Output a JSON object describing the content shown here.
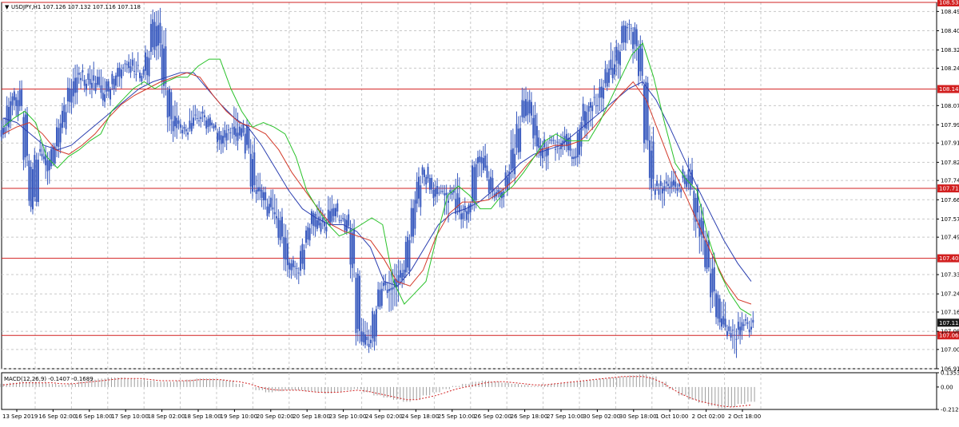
{
  "header": {
    "symbol_line": "USDJPY,H1  107.126 107.132 107.116 107.118",
    "macd_line": "MACD(12,26,9) -0.1407 -0.1689"
  },
  "colors": {
    "candle": "#3a5bbf",
    "ma_fast": "#29c229",
    "ma_mid": "#d33a2a",
    "ma_slow": "#2b3fb0",
    "level_line": "#d22020",
    "level_label_bg": "#d22020",
    "current_price_bg": "#1a1a1a",
    "grid": "#c8c8c8",
    "macd_hist": "#9e9e9e",
    "macd_signal": "#d22020"
  },
  "chart_data": {
    "type": "candlestick",
    "title": "USDJPY,H1",
    "ohlc_readout": [
      107.126,
      107.132,
      107.116,
      107.118
    ],
    "y_ticks": [
      "108.490",
      "108.405",
      "108.320",
      "108.240",
      "108.075",
      "107.990",
      "107.910",
      "107.825",
      "107.745",
      "107.660",
      "107.575",
      "107.495",
      "107.330",
      "107.245",
      "107.165",
      "107.080",
      "107.000",
      "106.915"
    ],
    "ylim": [
      106.915,
      108.53
    ],
    "x_labels": [
      "13 Sep 2019",
      "16 Sep 02:00",
      "16 Sep 18:00",
      "17 Sep 10:00",
      "18 Sep 02:00",
      "18 Sep 18:00",
      "19 Sep 10:00",
      "20 Sep 02:00",
      "20 Sep 18:00",
      "23 Sep 10:00",
      "24 Sep 02:00",
      "24 Sep 18:00",
      "25 Sep 10:00",
      "26 Sep 02:00",
      "26 Sep 18:00",
      "27 Sep 10:00",
      "30 Sep 02:00",
      "30 Sep 18:00",
      "1 Oct 10:00",
      "2 Oct 02:00",
      "2 Oct 18:00"
    ],
    "levels": [
      {
        "value": 108.53,
        "label": "108.53?"
      },
      {
        "value": 108.148,
        "label": "108.148"
      },
      {
        "value": 107.71,
        "label": "107.710"
      },
      {
        "value": 107.402,
        "label": "107.402"
      },
      {
        "value": 107.062,
        "label": "107.062"
      }
    ],
    "current_price": {
      "value": 107.118,
      "label": "107.118"
    },
    "price_path": [
      107.95,
      108.05,
      108.15,
      108.08,
      107.98,
      107.55,
      107.82,
      107.9,
      107.78,
      107.86,
      107.95,
      108.05,
      108.1,
      108.2,
      108.22,
      108.15,
      108.2,
      108.18,
      108.1,
      108.15,
      108.2,
      108.25,
      108.28,
      108.22,
      108.25,
      108.2,
      108.22,
      108.45,
      108.4,
      108.2,
      108.05,
      107.95,
      108.0,
      107.95,
      108.02,
      108.0,
      108.05,
      107.98,
      108.0,
      107.92,
      107.95,
      108.0,
      107.9,
      107.98,
      107.95,
      107.72,
      107.7,
      107.68,
      107.6,
      107.62,
      107.55,
      107.4,
      107.38,
      107.32,
      107.45,
      107.48,
      107.6,
      107.55,
      107.52,
      107.65,
      107.58,
      107.6,
      107.55,
      107.48,
      107.1,
      107.05,
      107.0,
      107.15,
      107.25,
      107.3,
      107.25,
      107.32,
      107.3,
      107.45,
      107.6,
      107.72,
      107.8,
      107.75,
      107.68,
      107.7,
      107.65,
      107.72,
      107.62,
      107.6,
      107.55,
      107.78,
      107.85,
      107.8,
      107.72,
      107.68,
      107.7,
      107.75,
      107.85,
      107.95,
      108.1,
      108.05,
      107.95,
      107.85,
      107.9,
      107.92,
      107.88,
      107.95,
      107.9,
      107.82,
      107.95,
      108.05,
      108.1,
      108.08,
      108.12,
      108.2,
      108.25,
      108.3,
      108.4,
      108.45,
      108.35,
      108.3,
      108.0,
      107.75,
      107.7,
      107.72,
      107.75,
      107.72,
      107.7,
      107.78,
      107.75,
      107.6,
      107.55,
      107.4,
      107.3,
      107.15,
      107.1,
      107.08,
      107.05,
      107.1,
      107.12,
      107.1
    ],
    "ma_fast": [
      107.98,
      108.02,
      108.05,
      108.0,
      107.85,
      107.8,
      107.85,
      107.88,
      107.92,
      107.95,
      108.05,
      108.1,
      108.15,
      108.18,
      108.15,
      108.18,
      108.2,
      108.2,
      108.25,
      108.28,
      108.28,
      108.15,
      108.05,
      107.98,
      108.0,
      107.98,
      107.95,
      107.85,
      107.7,
      107.62,
      107.55,
      107.5,
      107.52,
      107.55,
      107.58,
      107.55,
      107.3,
      107.2,
      107.25,
      107.3,
      107.5,
      107.68,
      107.72,
      107.68,
      107.62,
      107.62,
      107.68,
      107.72,
      107.78,
      107.85,
      107.92,
      107.95,
      107.92,
      107.92,
      107.92,
      108.0,
      108.1,
      108.2,
      108.3,
      108.35,
      108.2,
      108.0,
      107.82,
      107.75,
      107.7,
      107.5,
      107.35,
      107.25,
      107.18,
      107.15
    ],
    "ma_mid": [
      107.95,
      107.98,
      108.0,
      107.95,
      107.88,
      107.86,
      107.9,
      107.95,
      108.02,
      108.08,
      108.12,
      108.15,
      108.18,
      108.2,
      108.22,
      108.2,
      108.12,
      108.05,
      108.0,
      107.98,
      107.95,
      107.88,
      107.78,
      107.7,
      107.62,
      107.55,
      107.52,
      107.5,
      107.48,
      107.4,
      107.3,
      107.28,
      107.35,
      107.5,
      107.6,
      107.65,
      107.65,
      107.66,
      107.7,
      107.75,
      107.82,
      107.88,
      107.9,
      107.9,
      107.92,
      107.98,
      108.05,
      108.12,
      108.18,
      108.1,
      107.95,
      107.8,
      107.68,
      107.55,
      107.42,
      107.3,
      107.22,
      107.2
    ],
    "ma_slow": [
      108.02,
      108.0,
      107.95,
      107.9,
      107.88,
      107.9,
      107.95,
      108.0,
      108.05,
      108.1,
      108.15,
      108.18,
      108.2,
      108.22,
      108.22,
      108.15,
      108.08,
      108.02,
      107.98,
      107.9,
      107.8,
      107.7,
      107.62,
      107.58,
      107.55,
      107.55,
      107.52,
      107.45,
      107.3,
      107.28,
      107.35,
      107.45,
      107.55,
      107.6,
      107.62,
      107.65,
      107.7,
      107.76,
      107.82,
      107.86,
      107.88,
      107.9,
      107.95,
      108.0,
      108.05,
      108.1,
      108.15,
      108.18,
      108.1,
      107.98,
      107.85,
      107.72,
      107.6,
      107.48,
      107.38,
      107.3
    ],
    "macd": {
      "ylim": [
        -0.2124,
        0.1353
      ],
      "y_ticks": [
        "0.1353",
        "0.00",
        "-0.2124"
      ],
      "hist": [
        0.03,
        0.04,
        0.05,
        0.05,
        0.04,
        0.03,
        0.02,
        0.03,
        0.05,
        0.07,
        0.08,
        0.09,
        0.09,
        0.08,
        0.07,
        0.06,
        0.05,
        0.05,
        0.06,
        0.07,
        0.08,
        0.08,
        0.07,
        0.06,
        0.03,
        0.0,
        -0.03,
        -0.05,
        -0.04,
        -0.03,
        -0.03,
        -0.04,
        -0.05,
        -0.06,
        -0.05,
        -0.03,
        -0.02,
        -0.05,
        -0.08,
        -0.1,
        -0.12,
        -0.14,
        -0.12,
        -0.08,
        -0.05,
        -0.02,
        0.01,
        0.03,
        0.05,
        0.06,
        0.05,
        0.04,
        0.03,
        0.02,
        0.01,
        0.02,
        0.03,
        0.04,
        0.05,
        0.06,
        0.07,
        0.08,
        0.09,
        0.1,
        0.11,
        0.12,
        0.1,
        0.05,
        -0.02,
        -0.08,
        -0.12,
        -0.15,
        -0.18,
        -0.2,
        -0.19,
        -0.16,
        -0.14
      ],
      "signal": [
        0.02,
        0.03,
        0.04,
        0.04,
        0.04,
        0.04,
        0.03,
        0.03,
        0.04,
        0.05,
        0.06,
        0.07,
        0.08,
        0.08,
        0.08,
        0.07,
        0.06,
        0.06,
        0.06,
        0.06,
        0.07,
        0.07,
        0.07,
        0.06,
        0.05,
        0.03,
        0.0,
        -0.02,
        -0.03,
        -0.03,
        -0.03,
        -0.04,
        -0.05,
        -0.05,
        -0.05,
        -0.04,
        -0.03,
        -0.04,
        -0.06,
        -0.08,
        -0.1,
        -0.12,
        -0.12,
        -0.1,
        -0.08,
        -0.05,
        -0.02,
        0.0,
        0.02,
        0.04,
        0.05,
        0.05,
        0.04,
        0.03,
        0.02,
        0.02,
        0.03,
        0.04,
        0.05,
        0.06,
        0.07,
        0.08,
        0.09,
        0.1,
        0.1,
        0.1,
        0.08,
        0.04,
        -0.02,
        -0.07,
        -0.11,
        -0.14,
        -0.16,
        -0.18,
        -0.19,
        -0.18,
        -0.17
      ]
    }
  }
}
